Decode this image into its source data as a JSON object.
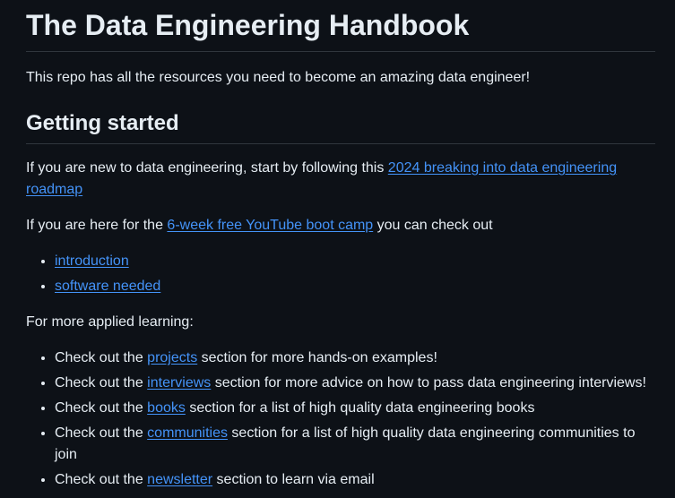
{
  "title": "The Data Engineering Handbook",
  "intro": "This repo has all the resources you need to become an amazing data engineer!",
  "getting_started": {
    "heading": "Getting started",
    "p1_prefix": "If you are new to data engineering, start by following this ",
    "p1_link": "2024 breaking into data engineering roadmap",
    "p2_prefix": "If you are here for the ",
    "p2_link": "6-week free YouTube boot camp",
    "p2_suffix": " you can check out",
    "bootcamp_links": [
      "introduction",
      "software needed"
    ],
    "applied_label": "For more applied learning:",
    "applied_items": [
      {
        "prefix": "Check out the ",
        "link": "projects",
        "suffix": " section for more hands-on examples!"
      },
      {
        "prefix": "Check out the ",
        "link": "interviews",
        "suffix": " section for more advice on how to pass data engineering interviews!"
      },
      {
        "prefix": "Check out the ",
        "link": "books",
        "suffix": " section for a list of high quality data engineering books"
      },
      {
        "prefix": "Check out the ",
        "link": "communities",
        "suffix": " section for a list of high quality data engineering communities to join"
      },
      {
        "prefix": "Check out the ",
        "link": "newsletter",
        "suffix": " section to learn via email"
      }
    ]
  }
}
